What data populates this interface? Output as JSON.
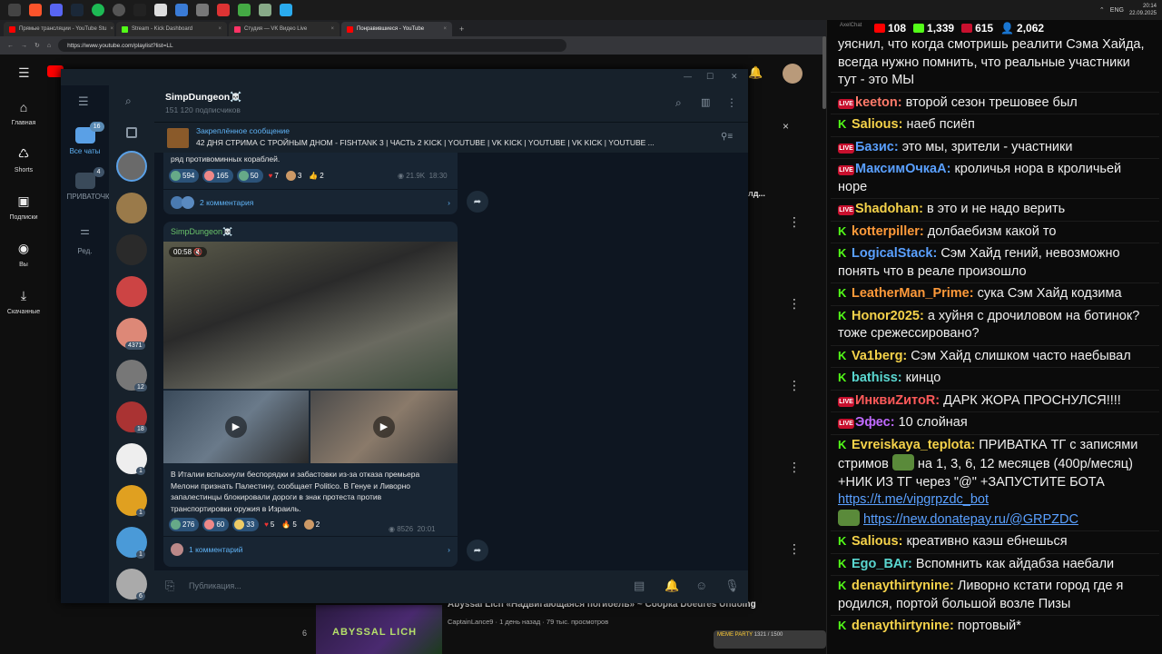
{
  "taskbar": {
    "clock_time": "20:14",
    "clock_date": "22.09.2025",
    "lang": "ENG"
  },
  "browser": {
    "tabs": [
      {
        "label": "Прямые трансляции - YouTube Stu",
        "color": "#ff0000"
      },
      {
        "label": "Stream - Kick Dashboard",
        "color": "#53fc18"
      },
      {
        "label": "Студия — VK Видео Live",
        "color": "#ff3366"
      },
      {
        "label": "Понравившиеся - YouTube",
        "color": "#ff0000"
      }
    ],
    "url": "https://www.youtube.com/playlist?list=LL"
  },
  "youtube": {
    "nav": [
      {
        "label": "Главная",
        "icon": "home-icon",
        "glyph": "⌂"
      },
      {
        "label": "Shorts",
        "icon": "shorts-icon",
        "glyph": "♺"
      },
      {
        "label": "Подписки",
        "icon": "subscriptions-icon",
        "glyph": "▣"
      },
      {
        "label": "Вы",
        "icon": "you-icon",
        "glyph": "◉"
      },
      {
        "label": "Скачанные",
        "icon": "download-icon",
        "glyph": "⤓"
      }
    ],
    "bottom_index": "6",
    "bottom_title": "Abyssal Lich «Надвигающаяся погибель» ~ Сборка Doedres Undoing",
    "bottom_meta": "CaptainLance9 · 1 день назад · 79 тыс. просмотров",
    "thumb_text": "ABYSSAL LICH",
    "side_text": "лд..."
  },
  "telegram": {
    "folders": [
      {
        "label": "Все чаты",
        "badge": "16"
      },
      {
        "label": "ПРИВАТОЧКА",
        "badge": "4"
      },
      {
        "label": "Ред.",
        "badge": ""
      }
    ],
    "chat_badges": [
      "4371",
      "12",
      "18",
      "1",
      "1",
      "1",
      "6"
    ],
    "channel_name": "SimpDungeon☠️",
    "subscribers": "151 120 подписчиков",
    "pinned_title": "Закреплённое сообщение",
    "pinned_text": "42 ДНЯ СТРИМА С ТРОЙНЫМ ДНОМ - FISHTANK 3 | ЧАСТЬ 2 KICK | YOUTUBE | VK KICK | YOUTUBE | VK KICK | YOUTUBE ...",
    "msg1": {
      "text_tail": "ряд противоминных кораблей.",
      "reactions": [
        "594",
        "165",
        "50",
        "7",
        "3",
        "2"
      ],
      "views": "21.9K",
      "time": "18:30",
      "comments": "2 комментария"
    },
    "msg2": {
      "author": "SimpDungeon☠️",
      "video_time": "00:58",
      "text": "В Италии вспыхнули беспорядки и забастовки из-за отказа премьера Мелони признать Палестину, сообщает Politico. В Генуе и Ливорно запалестинцы блокировали дороги в знак протеста против транспортировки оружия в Израиль.",
      "reactions": [
        "276",
        "60",
        "33",
        "5",
        "5",
        "2"
      ],
      "views": "8526",
      "time": "20:01",
      "comments": "1 комментарий"
    },
    "input_placeholder": "Публикация..."
  },
  "chat": {
    "app_label": "AxelChat",
    "stats": [
      {
        "value": "108",
        "color": "#ff0000"
      },
      {
        "value": "1,339",
        "color": "#53fc18"
      },
      {
        "value": "615",
        "color": "#c8102e"
      },
      {
        "value": "2,062",
        "color": "#5aa0ff"
      }
    ],
    "messages": [
      {
        "platform": "",
        "user": "",
        "color": "#efefef",
        "text": "уяснил, что когда смотришь реалити Сэма Хайда, всегда нужно помнить, что реальные участники тут - это МЫ"
      },
      {
        "platform": "vk",
        "user": "keeton:",
        "color": "#ff7a6a",
        "text": "второй сезон трешовее был"
      },
      {
        "platform": "kick",
        "user": "Salious:",
        "color": "#f5d24a",
        "text": "наеб псиёп"
      },
      {
        "platform": "vk",
        "user": "Базис:",
        "color": "#5aa0ff",
        "text": "это мы, зрители - участники"
      },
      {
        "platform": "vk",
        "user": "МаксимОчкаА:",
        "color": "#5aa0ff",
        "text": "кроличья нора в кроличьей норе"
      },
      {
        "platform": "vk",
        "user": "Shadohan:",
        "color": "#f5d24a",
        "text": "в это и не надо верить"
      },
      {
        "platform": "kick",
        "user": "kotterpiller:",
        "color": "#ff9a3a",
        "text": "долбаебизм какой то"
      },
      {
        "platform": "kick",
        "user": "LogicalStack:",
        "color": "#5aa0ff",
        "text": "Сэм Хайд гений, невозможно понять что в реале произошло"
      },
      {
        "platform": "kick",
        "user": "LeatherMan_Prime:",
        "color": "#ff9a3a",
        "text": "сука Сэм Хайд кодзима"
      },
      {
        "platform": "kick",
        "user": "Honor2025:",
        "color": "#f5d24a",
        "text": "а хуйня с дрочиловом на ботинок? тоже срежессировано?"
      },
      {
        "platform": "kick",
        "user": "Va1berg:",
        "color": "#f5d24a",
        "text": "Сэм Хайд слишком часто наебывал"
      },
      {
        "platform": "kick",
        "user": "bathiss:",
        "color": "#5ad7d0",
        "text": "кинцо"
      },
      {
        "platform": "vk",
        "user": "ИнквиZитоR:",
        "color": "#ff5a5a",
        "text": "ДАРК ЖОРА ПРОСНУЛСЯ!!!!"
      },
      {
        "platform": "vk",
        "user": "Эфес:",
        "color": "#c06aff",
        "text": "10 слойная"
      },
      {
        "platform": "kick",
        "user": "Evreiskaya_teplota:",
        "color": "#f5d24a",
        "text": "ПРИВАТКА ТГ с записями стримов",
        "text2": "на 1, 3, 6, 12 месяцев (400р/месяц) +НИК ИЗ ТГ через \"@\" +ЗАПУСТИТЕ БОТА",
        "link1": "https://t.me/vipgrpzdc_bot",
        "link2": "https://new.donatepay.ru/@GRPZDC"
      },
      {
        "platform": "kick",
        "user": "Salious:",
        "color": "#f5d24a",
        "text": "креативно каэш ебнешься"
      },
      {
        "platform": "kick",
        "user": "Ego_BAr:",
        "color": "#5ad7d0",
        "text": "Вспомнить как айдабза наебали"
      },
      {
        "platform": "kick",
        "user": "denaythirtynine:",
        "color": "#f5d24a",
        "text": "Ливорно кстати город где я родился, портой большой возле Пизы"
      },
      {
        "platform": "kick",
        "user": "denaythirtynine:",
        "color": "#f5d24a",
        "text": "портовый*"
      }
    ],
    "meme_label": "MEME PARTY",
    "meme_progress": "1321 / 1500"
  }
}
